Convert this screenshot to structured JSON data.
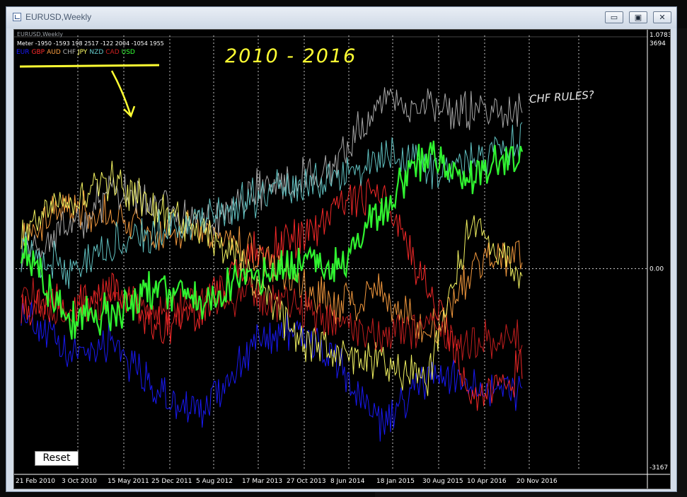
{
  "window": {
    "title": "EURUSD,Weekly",
    "buttons": {
      "minimize": "▭",
      "restore": "▣",
      "close": "✕"
    }
  },
  "chart": {
    "symbol_label": "EURUSD,Weekly",
    "price_top": "1.07834",
    "scale_top": "3694",
    "scale_zero": "0.00",
    "scale_bottom": "-3167",
    "indicator_label": "Meter -1950 -1593 198 2517 -122 2004 -1054 1955",
    "reset_label": "Reset",
    "annotation_years": "2010 - 2016",
    "annotation_note": "CHF RULES?"
  },
  "legend": [
    {
      "name": "EUR",
      "color": "#1a1aff"
    },
    {
      "name": "GBP",
      "color": "#ff2a2a"
    },
    {
      "name": "AUD",
      "color": "#ffa040"
    },
    {
      "name": "CHF",
      "color": "#b0b0b0"
    },
    {
      "name": "JPY",
      "color": "#ffff66"
    },
    {
      "name": "NZD",
      "color": "#66cccc"
    },
    {
      "name": "CAD",
      "color": "#cc2020"
    },
    {
      "name": "USD",
      "color": "#33ff33"
    }
  ],
  "x_labels": [
    "21 Feb 2010",
    "3 Oct 2010",
    "15 May 2011",
    "25 Dec 2011",
    "5 Aug 2012",
    "17 Mar 2013",
    "27 Oct 2013",
    "8 Jun 2014",
    "18 Jan 2015",
    "30 Aug 2015",
    "10 Apr 2016",
    "20 Nov 2016"
  ],
  "chart_data": {
    "type": "line",
    "x": [
      "21 Feb 2010",
      "3 Oct 2010",
      "15 May 2011",
      "25 Dec 2011",
      "5 Aug 2012",
      "17 Mar 2013",
      "27 Oct 2013",
      "8 Jun 2014",
      "18 Jan 2015",
      "30 Aug 2015",
      "10 Apr 2016",
      "20 Nov 2016"
    ],
    "ylim": [
      -3167,
      3694
    ],
    "grid": true,
    "series": [
      {
        "name": "EUR",
        "color": "#1a1aff",
        "values": [
          -600,
          -1400,
          -1100,
          -2000,
          -2300,
          -1300,
          -900,
          -1500,
          -2500,
          -1700,
          -1800,
          -1950
        ]
      },
      {
        "name": "GBP",
        "color": "#ff2a2a",
        "values": [
          -500,
          -600,
          -300,
          -900,
          -700,
          200,
          400,
          1000,
          1200,
          -300,
          -2000,
          -1593
        ]
      },
      {
        "name": "AUD",
        "color": "#ffa040",
        "values": [
          500,
          1000,
          800,
          500,
          600,
          300,
          -200,
          -600,
          -400,
          -1100,
          0,
          198
        ]
      },
      {
        "name": "CHF",
        "color": "#b0b0b0",
        "values": [
          200,
          600,
          1200,
          1000,
          700,
          1200,
          1400,
          1600,
          2700,
          2600,
          2500,
          2517
        ]
      },
      {
        "name": "JPY",
        "color": "#ffff66",
        "values": [
          600,
          1100,
          1400,
          900,
          600,
          0,
          -1000,
          -1400,
          -1500,
          -1700,
          800,
          -122
        ]
      },
      {
        "name": "NZD",
        "color": "#66cccc",
        "values": [
          300,
          0,
          400,
          600,
          800,
          1100,
          1300,
          1400,
          1800,
          1600,
          1700,
          2004
        ]
      },
      {
        "name": "CAD",
        "color": "#cc2020",
        "values": [
          -300,
          -800,
          -400,
          -700,
          -500,
          -400,
          -600,
          -900,
          -1100,
          -900,
          -1200,
          -1054
        ]
      },
      {
        "name": "USD",
        "color": "#33ff33",
        "values": [
          300,
          -800,
          -700,
          -300,
          -500,
          -200,
          100,
          0,
          1000,
          1800,
          1400,
          1955
        ]
      }
    ]
  }
}
